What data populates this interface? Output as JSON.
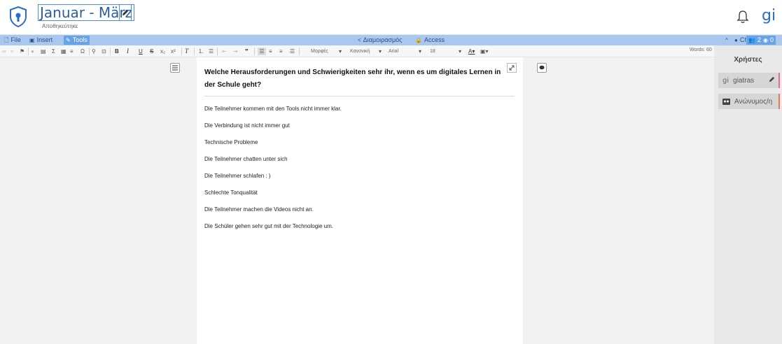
{
  "header": {
    "title": "Januar - März",
    "saved_status": "Αποθηκεύτηκε",
    "user_initials": "gi"
  },
  "menubar": {
    "file": "File",
    "insert": "Insert",
    "tools": "Tools",
    "share": "Διαμοιρασμός",
    "access": "Access",
    "chat": "Chat",
    "user_count": "2",
    "viewer_count": "0"
  },
  "toolbar": {
    "format_combo": "Μορφές",
    "style_combo": "Κανονική",
    "font_combo": "Arial",
    "size_combo": "18",
    "word_count": "Words: 60"
  },
  "users_panel": {
    "title": "Χρήστες",
    "users": [
      {
        "initials": "gi",
        "name": "giatras"
      },
      {
        "name": "Ανώνυμος/η"
      }
    ]
  },
  "document": {
    "heading": "Welche Herausforderungen und Schwierigkeiten sehr ihr, wenn es um digitales Lernen in der Schule geht?",
    "paragraphs": [
      "Die Teilnehmer kommen mit den Tools nicht immer klar.",
      "Die Verbindung ist nicht immer gut",
      "Technische Probleme",
      "Die Teilnehmer chatten unter sich",
      "Die Teilnehmer schlafen : )",
      "Schlechte Tonqualität",
      "Die Teilnehmer machen die Videos nicht an.",
      "Die Schüler gehen sehr gut mit der Technologie um."
    ]
  },
  "colors": {
    "menubar_bg": "#a9c8ee",
    "menubar_active": "#6aa2e6",
    "title_blue": "#2a5f9e",
    "user_accent": "#2b6cc4"
  }
}
